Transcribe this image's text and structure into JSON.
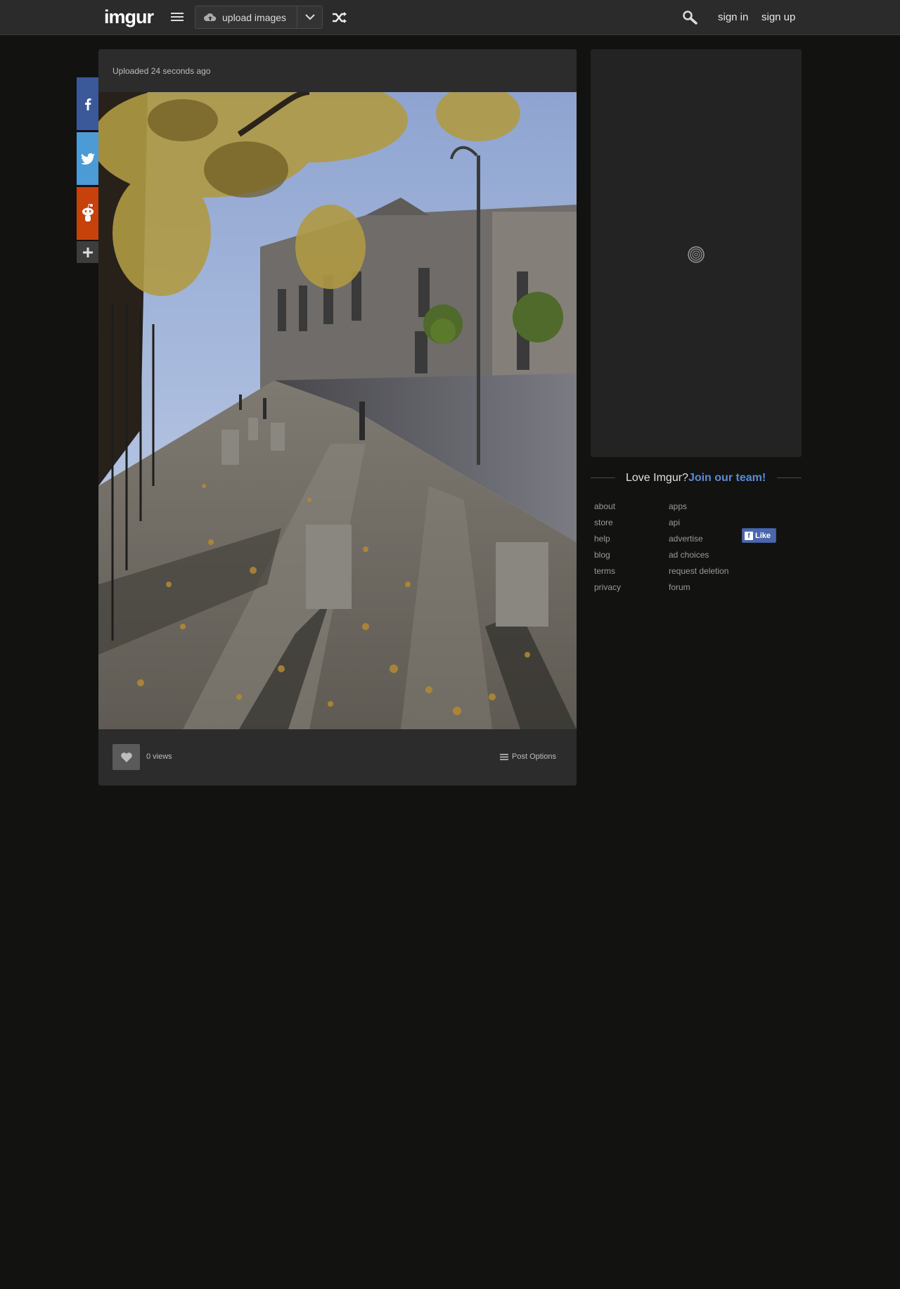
{
  "header": {
    "logo_text": "imgur",
    "upload_label": "upload images",
    "sign_in": "sign in",
    "sign_up": "sign up"
  },
  "post": {
    "uploaded_prefix": "Uploaded",
    "uploaded_time": "24 seconds ago",
    "views": "0 views",
    "post_options": "Post Options"
  },
  "sidebar": {
    "love_text": "Love Imgur?",
    "join_link": "Join our team!",
    "footer_col1": [
      "about",
      "store",
      "help",
      "blog",
      "terms",
      "privacy"
    ],
    "footer_col2": [
      "apps",
      "api",
      "advertise",
      "ad choices",
      "request deletion",
      "forum"
    ],
    "fb_like": "Like"
  },
  "colors": {
    "background": "#121211",
    "topbar": "#2b2b2b",
    "panel": "#2c2c2c",
    "facebook": "#3b5998",
    "twitter": "#4c9bd6",
    "reddit": "#c7420b",
    "link_accent": "#5b8ad8"
  }
}
